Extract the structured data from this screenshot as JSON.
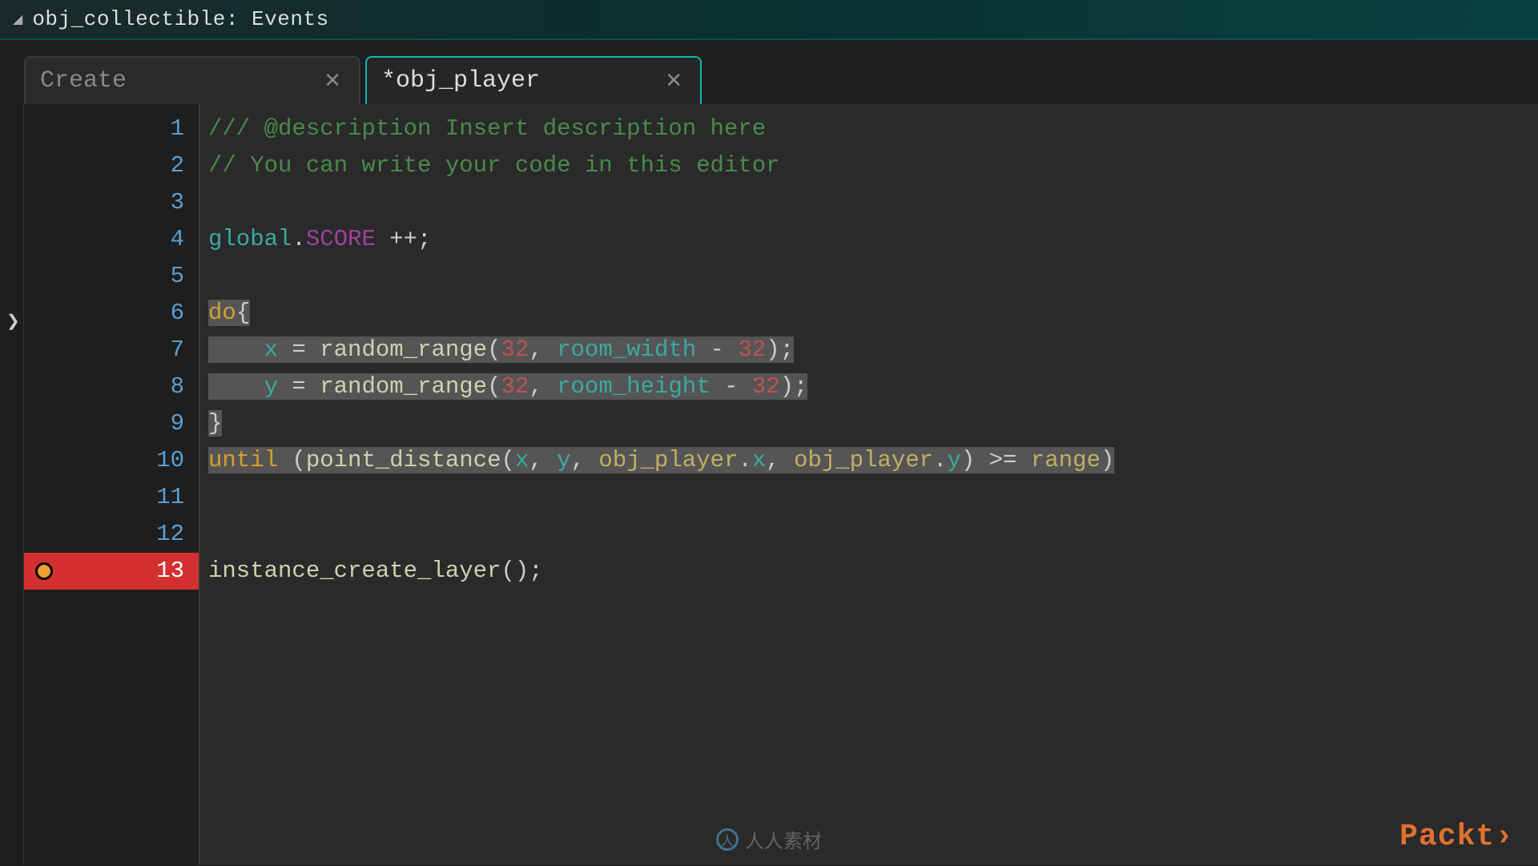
{
  "window": {
    "title": "obj_collectible: Events"
  },
  "tabs": [
    {
      "label": "Create",
      "active": false
    },
    {
      "label": "*obj_player",
      "active": true
    }
  ],
  "gutter": {
    "line_count": 13,
    "error_line": 13
  },
  "code": {
    "l1_a": "/// @description Insert description here",
    "l2_a": "// You can write your code in this editor",
    "l4_global": "global",
    "l4_dot": ".",
    "l4_score": "SCORE",
    "l4_rest": " ++;",
    "l6_do": "do",
    "l6_brace": "{",
    "l7_indent": "    ",
    "l7_x": "x",
    "l7_eq": " = ",
    "l7_fn": "random_range",
    "l7_open": "(",
    "l7_n1": "32",
    "l7_comma": ", ",
    "l7_rw": "room_width",
    "l7_minus": " - ",
    "l7_n2": "32",
    "l7_close": ");",
    "l8_indent": "    ",
    "l8_y": "y",
    "l8_eq": " = ",
    "l8_fn": "random_range",
    "l8_open": "(",
    "l8_n1": "32",
    "l8_comma": ", ",
    "l8_rh": "room_height",
    "l8_minus": " - ",
    "l8_n2": "32",
    "l8_close": ");",
    "l9_brace": "}",
    "l10_until": "until",
    "l10_sp": " ",
    "l10_open": "(",
    "l10_fn": "point_distance",
    "l10_p1": "(",
    "l10_x": "x",
    "l10_c1": ", ",
    "l10_y": "y",
    "l10_c2": ", ",
    "l10_op1": "obj_player",
    "l10_d1": ".",
    "l10_px": "x",
    "l10_c3": ", ",
    "l10_op2": "obj_player",
    "l10_d2": ".",
    "l10_py": "y",
    "l10_p2": ")",
    "l10_ge": " >= ",
    "l10_range": "range",
    "l10_close": ")",
    "l13_fn": "instance_create_layer",
    "l13_rest": "();"
  },
  "watermarks": {
    "center": "人人素材",
    "right": "Packt›"
  }
}
